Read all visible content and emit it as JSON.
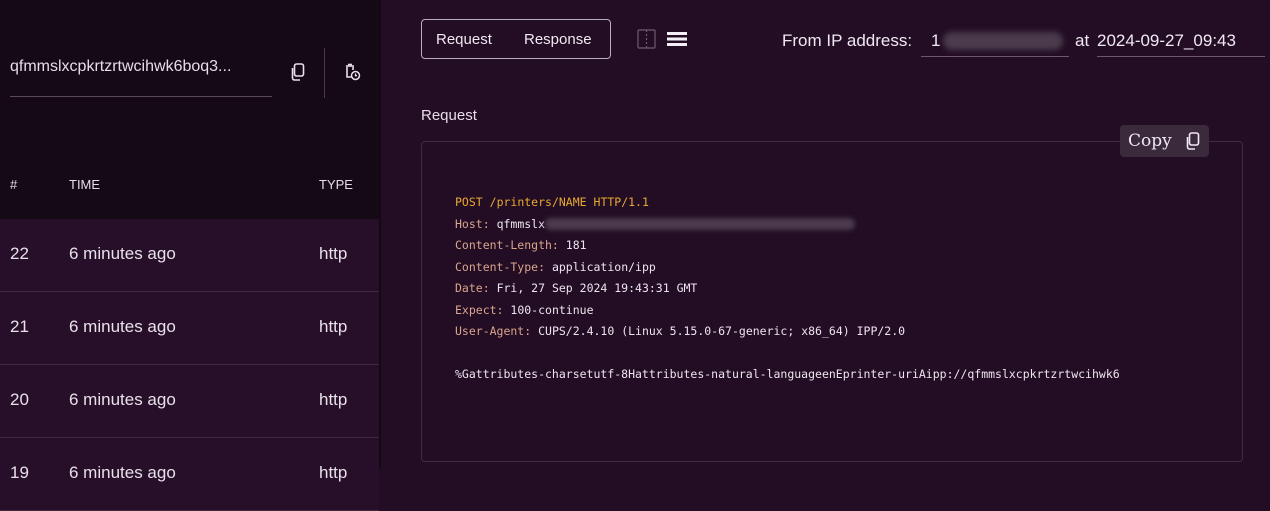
{
  "sidebar": {
    "domain": "qfmmslxcpkrtzrtwcihwk6boq3...",
    "columns": {
      "num": "#",
      "time": "TIME",
      "type": "TYPE"
    },
    "rows": [
      {
        "num": "22",
        "time": "6 minutes ago",
        "type": "http"
      },
      {
        "num": "21",
        "time": "6 minutes ago",
        "type": "http"
      },
      {
        "num": "20",
        "time": "6 minutes ago",
        "type": "http"
      },
      {
        "num": "19",
        "time": "6 minutes ago",
        "type": "http"
      }
    ]
  },
  "toolbar": {
    "request_tab": "Request",
    "response_tab": "Response",
    "from_label": "From IP address:",
    "ip_first_char": "1",
    "at_label": "at",
    "timestamp": "2024-09-27_09:43"
  },
  "request": {
    "heading": "Request",
    "copy_label": "Copy",
    "method": "POST",
    "path": "/printers/NAME",
    "protocol": "HTTP/1.1",
    "host_key": "Host:",
    "host_val": "qfmmslx",
    "content_length_key": "Content-Length:",
    "content_length_val": "181",
    "content_type_key": "Content-Type:",
    "content_type_val": "application/ipp",
    "date_key": "Date:",
    "date_val": "Fri, 27 Sep 2024 19:43:31 GMT",
    "expect_key": "Expect:",
    "expect_val": "100-continue",
    "ua_key": "User-Agent:",
    "ua_val": "CUPS/2.4.10 (Linux 5.15.0-67-generic; x86_64) IPP/2.0",
    "body": "%Gattributes-charsetutf-8Hattributes-natural-languageenEprinter-uriAipp://qfmmslxcpkrtzrtwcihwk6"
  },
  "colors": {
    "background": "#230d24",
    "sidebar_header": "#160916",
    "row": "#280f29",
    "method_accent": "#e8a830",
    "header_key": "#d9a58c"
  }
}
